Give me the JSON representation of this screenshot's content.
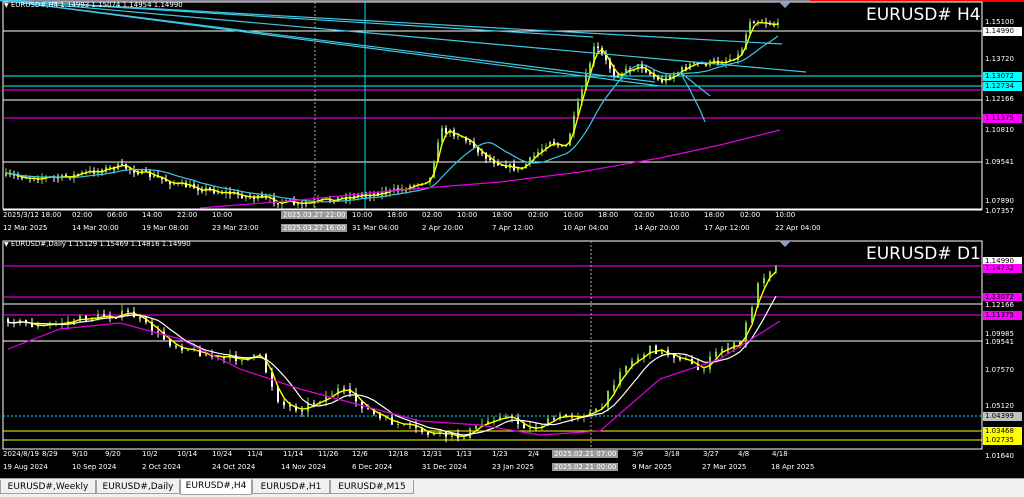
{
  "h4": {
    "info": "EURUSD#,H4  1.14993 1.15074 1.14954 1.14990",
    "title": "EURUSD# H4",
    "price_labels": [
      {
        "text": "1.15100",
        "color": "#ffffff",
        "bg": "#000000"
      },
      {
        "text": "1.14990",
        "color": "#000000",
        "bg": "#ffffff"
      },
      {
        "text": "1.13720",
        "color": "#ffffff",
        "bg": "#000000"
      },
      {
        "text": "1.13072",
        "color": "#000000",
        "bg": "#00ffff"
      },
      {
        "text": "1.12734",
        "color": "#000000",
        "bg": "#00ffff"
      },
      {
        "text": "1.12166",
        "color": "#ffffff",
        "bg": "#000000"
      },
      {
        "text": "1.11375",
        "color": "#000000",
        "bg": "#ff00ff"
      },
      {
        "text": "1.10810",
        "color": "#ffffff",
        "bg": "#000000"
      },
      {
        "text": "1.09541",
        "color": "#ffffff",
        "bg": "#000000"
      },
      {
        "text": "1.07890",
        "color": "#ffffff",
        "bg": "#000000"
      },
      {
        "text": "1.07357",
        "color": "#ffffff",
        "bg": "#000000"
      }
    ],
    "time_upper": [
      "2025/3/12 18:00",
      "02:00",
      "06:00",
      "14:00",
      "22:00",
      "10:00",
      "2025.03.27 22:00",
      "10:00",
      "18:00",
      "02:00",
      "10:00",
      "18:00",
      "02:00",
      "10:00",
      "18:00",
      "02:00",
      "10:00",
      "18:00",
      "02:00",
      "10:00"
    ],
    "time_lower": [
      "12 Mar 2025",
      "14 Mar 20:00",
      "19 Mar 08:00",
      "23 Mar 23:00",
      "2025.03.27 16:00",
      "31 Mar 04:00",
      "2 Apr 20:00",
      "7 Apr 12:00",
      "10 Apr 04:00",
      "14 Apr 20:00",
      "17 Apr 12:00",
      "22 Apr 04:00"
    ]
  },
  "d1": {
    "info": "EURUSD#,Daily  1.15129 1.15469 1.14816 1.14990",
    "title": "EURUSD# D1",
    "price_labels": [
      {
        "text": "1.14990",
        "color": "#000000",
        "bg": "#ffffff"
      },
      {
        "text": "1.14732",
        "color": "#000000",
        "bg": "#ff00ff"
      },
      {
        "text": "1.13072",
        "color": "#000000",
        "bg": "#ff00ff"
      },
      {
        "text": "1.12166",
        "color": "#ffffff",
        "bg": "#000000"
      },
      {
        "text": "1.11375",
        "color": "#000000",
        "bg": "#ff00ff"
      },
      {
        "text": "1.09985",
        "color": "#ffffff",
        "bg": "#000000"
      },
      {
        "text": "1.09541",
        "color": "#ffffff",
        "bg": "#000000"
      },
      {
        "text": "1.07570",
        "color": "#ffffff",
        "bg": "#000000"
      },
      {
        "text": "1.05120",
        "color": "#ffffff",
        "bg": "#000000"
      },
      {
        "text": "1.04399",
        "color": "#000000",
        "bg": "#c0c0c0"
      },
      {
        "text": "1.03468",
        "color": "#000000",
        "bg": "#ffff00"
      },
      {
        "text": "1.02735",
        "color": "#000000",
        "bg": "#ffff00"
      },
      {
        "text": "1.01640",
        "color": "#ffffff",
        "bg": "#000000"
      }
    ],
    "time_upper": [
      "2024/8/19",
      "8/29",
      "9/10",
      "9/20",
      "10/2",
      "10/14",
      "10/24",
      "11/4",
      "11/14",
      "11/26",
      "12/6",
      "12/18",
      "12/31",
      "1/13",
      "1/23",
      "2/4",
      "2025.02.21 07:00",
      "3/9",
      "3/18",
      "3/27",
      "4/8",
      "4/18"
    ],
    "time_lower": [
      "19 Aug 2024",
      "10 Sep 2024",
      "2 Oct 2024",
      "24 Oct 2024",
      "14 Nov 2024",
      "6 Dec 2024",
      "31 Dec 2024",
      "23 Jan 2025",
      "2025.02.21 00:00",
      "9 Mar 2025",
      "27 Mar 2025",
      "18 Apr 2025"
    ]
  },
  "tabs": [
    "EURUSD#,Weekly",
    "EURUSD#,Daily",
    "EURUSD#,H4",
    "EURUSD#,H1",
    "EURUSD#,M15"
  ],
  "active_tab": "EURUSD#,H4",
  "colors": {
    "ma_yellow": "#ffff00",
    "ma_cyan": "#3cc8e6",
    "ma_magenta": "#e000e0",
    "bull": "#7cd44a",
    "bear": "#ffffff"
  }
}
